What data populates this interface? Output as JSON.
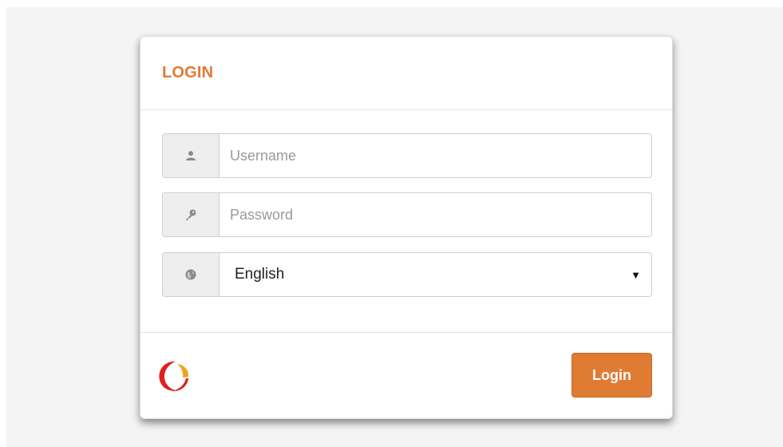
{
  "login": {
    "title": "LOGIN",
    "username": {
      "placeholder": "Username",
      "value": "",
      "icon": "user-icon"
    },
    "password": {
      "placeholder": "Password",
      "value": "",
      "icon": "key-icon"
    },
    "language": {
      "selected": "English",
      "icon": "globe-icon",
      "caret": "▼"
    },
    "submit_label": "Login"
  },
  "colors": {
    "accent": "#e07b34",
    "logo_red": "#e0201b",
    "logo_orange": "#f2a21f"
  }
}
